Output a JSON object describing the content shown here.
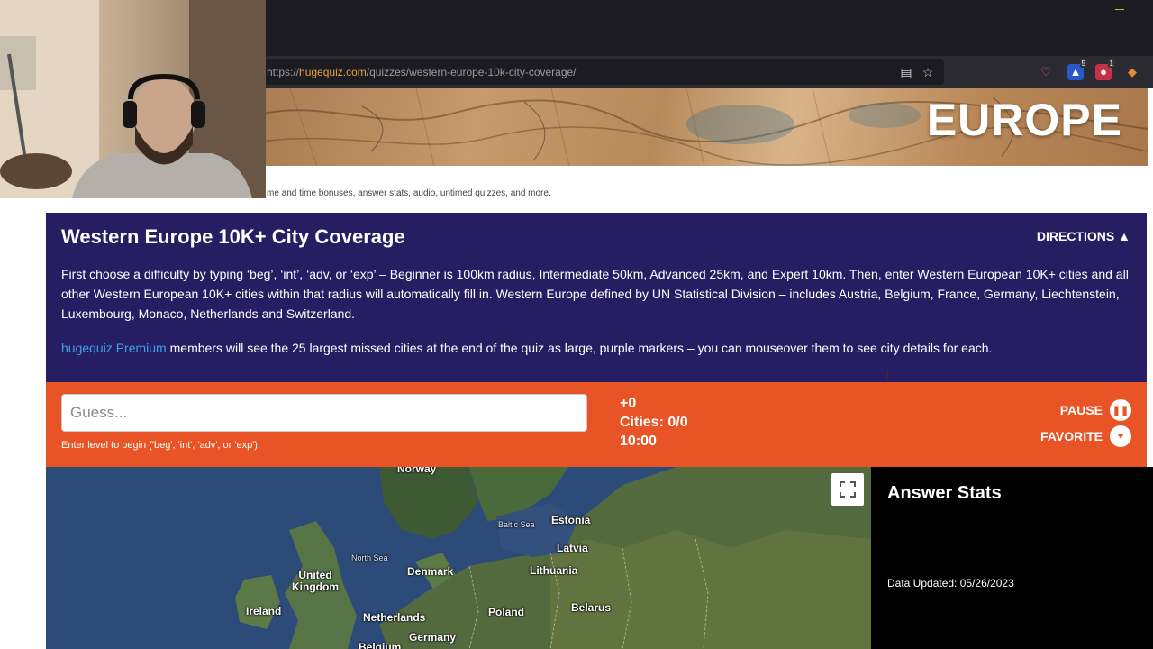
{
  "browser": {
    "url_prefix": "https://",
    "url_host": "hugequiz.com",
    "url_path": "/quizzes/western-europe-10k-city-coverage/",
    "extensions": [
      {
        "name": "pocket-icon",
        "badge": ""
      },
      {
        "name": "extension-icon",
        "badge": "5"
      },
      {
        "name": "alert-extension-icon",
        "badge": "1"
      },
      {
        "name": "metamask-icon",
        "badge": ""
      }
    ]
  },
  "banner": {
    "title": "EUROPE"
  },
  "promo_text": "me and time bonuses, answer stats, audio, untimed quizzes, and more.",
  "quiz": {
    "title": "Western Europe 10K+ City Coverage",
    "directions_label": "DIRECTIONS ▲",
    "description": "First choose a difficulty by typing ‘beg’, ‘int’, ‘adv, or ‘exp’ – Beginner is 100km radius, Intermediate 50km, Advanced 25km, and Expert 10km. Then, enter Western European 10K+ cities and all other Western European 10K+ cities within that radius will automatically fill in. Western Europe defined by UN Statistical Division – includes Austria, Belgium, France, Germany, Liechtenstein, Luxembourg, Monaco, Netherlands and Switzerland.",
    "premium_link": "hugequiz Premium",
    "premium_text": " members will see the 25 largest missed cities at the end of the quiz as large, purple markers – you can mouseover them to see city details for each."
  },
  "controls": {
    "guess_placeholder": "Guess...",
    "hint": "Enter level to begin ('beg', 'int', 'adv', or 'exp').",
    "bonus": "+0",
    "cities": "Cities: 0/0",
    "timer": "10:00",
    "pause_label": "PAUSE",
    "favorite_label": "FAVORITE"
  },
  "map": {
    "labels": {
      "estonia": "Estonia",
      "latvia": "Latvia",
      "lithuania": "Lithuania",
      "denmark": "Denmark",
      "uk_line1": "United",
      "uk_line2": "Kingdom",
      "ireland": "Ireland",
      "netherlands": "Netherlands",
      "poland": "Poland",
      "belarus": "Belarus",
      "germany": "Germany",
      "belgium": "Belgium",
      "north_sea": "North Sea",
      "baltic_sea": "Baltic Sea",
      "norway": "Norway"
    }
  },
  "answer_stats": {
    "title": "Answer Stats",
    "data_updated": "Data Updated: 05/26/2023"
  },
  "colors": {
    "header_bg": "#261d62",
    "controls_bg": "#e85425",
    "link": "#3fa2e8"
  }
}
